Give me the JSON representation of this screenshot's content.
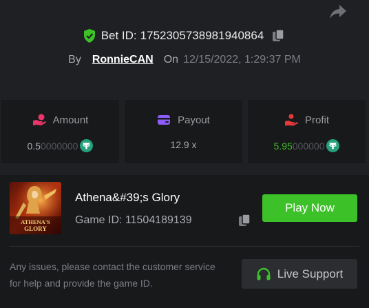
{
  "bet": {
    "id_label": "Bet ID:",
    "id_value": "1752305738981940864",
    "by_label": "By",
    "user": "RonnieCAN",
    "on_label": "On",
    "datetime": "12/15/2022, 1:29:37 PM"
  },
  "stats": {
    "amount": {
      "label": "Amount",
      "value_main": "0.5",
      "value_dim": "0000000",
      "icon": "coins-hand-icon"
    },
    "payout": {
      "label": "Payout",
      "value": "12.9 x",
      "icon": "wallet-card-icon"
    },
    "profit": {
      "label": "Profit",
      "value_main": "5.95",
      "value_dim": "000000",
      "icon": "hand-person-icon"
    }
  },
  "game": {
    "title": "Athena&#39;s Glory",
    "id_label": "Game ID:",
    "id_value": "11504189139",
    "thumb_text_line1": "ATHENA'S",
    "thumb_text_line2": "GLORY",
    "play_label": "Play Now"
  },
  "support": {
    "notice": "Any issues, please contact the customer service for help and provide the game ID.",
    "button_label": "Live Support"
  },
  "colors": {
    "background": "#1f2023",
    "card": "#18191b",
    "accent_green": "#3dc129",
    "tether": "#26a17b",
    "amount_icon": "#e9356b",
    "payout_icon": "#8b5cf6",
    "profit_icon": "#e5393a"
  }
}
